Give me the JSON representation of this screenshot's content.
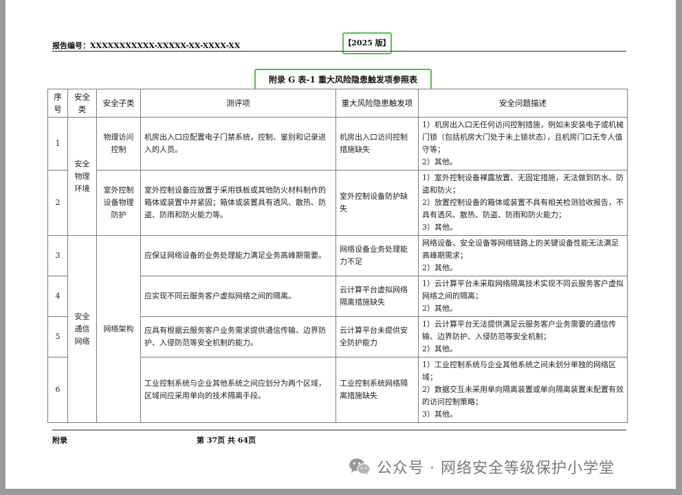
{
  "header": {
    "report_no": "报告编号：XXXXXXXXXXX-XXXXX-XX-XXXX-XX",
    "version": "【2025 版】"
  },
  "title": "附录 G  表-1  重大风险隐患触发项参照表",
  "table": {
    "columns": [
      "序号",
      "安全类",
      "安全子类",
      "测评项",
      "重大风险隐患触发项",
      "安全问题描述"
    ],
    "groups": [
      {
        "category": "安全物理环境",
        "subgroups": [
          {
            "subcategory": "物理访问控制",
            "rows": [
              {
                "no": "1",
                "item": "机房出入口应配置电子门禁系统，控制、鉴别和记录进入的人员。",
                "trigger": "机房出入口访问控制措施缺失",
                "issues": [
                  "1）机房出入口无任何访问控制措施，例如未安装电子或机械门锁（包括机房大门处于未上锁状态），且机房门口无专人值守等；",
                  "2）其他。"
                ]
              }
            ]
          },
          {
            "subcategory": "室外控制设备物理防护",
            "rows": [
              {
                "no": "2",
                "item": "室外控制设备应放置于采用铁板或其他防火材料制作的箱体或装置中并紧固；箱体或装置具有透风、散热、防盗、防雨和防火能力等。",
                "trigger": "室外控制设备防护缺失",
                "issues": [
                  "1）室外控制设备裸露放置、无固定措施，无法做到防水、防盗和防火；",
                  "2）放置控制设备的箱体或装置不具有相关检测验收报告，不具有透风、散热、防盗、防雨和防火能力；",
                  "3）其他。"
                ]
              }
            ]
          }
        ]
      },
      {
        "category": "安全通信网络",
        "subgroups": [
          {
            "subcategory": "网络架构",
            "rows": [
              {
                "no": "3",
                "item": "应保证网络设备的业务处理能力满足业务高峰期需要。",
                "trigger": "网络设备业务处理能力不足",
                "issues": [
                  "网络设备、安全设备等网络链路上的关键设备性能无法满足高峰期需求；",
                  "2）其他。"
                ]
              },
              {
                "no": "4",
                "item": "应实现不同云服务客户虚拟网络之间的隔离。",
                "trigger": "云计算平台虚拟网络隔离措施缺失",
                "issues": [
                  "1）云计算平台未采取网络隔离技术实现不同云服务客户虚拟网络之间的隔离；",
                  "2）其他。"
                ]
              },
              {
                "no": "5",
                "item": "应具有根据云服务客户业务需求提供通信传输、边界防护、入侵防范等安全机制的能力。",
                "trigger": "云计算平台未提供安全防护能力",
                "issues": [
                  "1）云计算平台无法提供满足云服务客户业务需要的通信传输、边界防护、入侵防范等安全机制；",
                  "2）其他。"
                ]
              },
              {
                "no": "6",
                "item": "工业控制系统与企业其他系统之间应划分为两个区域，区域间应采用单向的技术隔离手段。",
                "trigger": "工业控制系统网络隔离措施缺失",
                "issues": [
                  "1）工业控制系统与企业其他系统之间未划分单独的网络区域；",
                  "2）数据交互未采用单向隔离装置或单向隔离装置未配置有效的访问控制策略；",
                  "3）其他。"
                ]
              }
            ]
          }
        ]
      }
    ]
  },
  "footer": {
    "left": "附录",
    "page": "第 37页  共 64页"
  },
  "watermark": {
    "text": "公众号 · 网络安全等级保护小学堂",
    "icon": "wechat-icon"
  }
}
